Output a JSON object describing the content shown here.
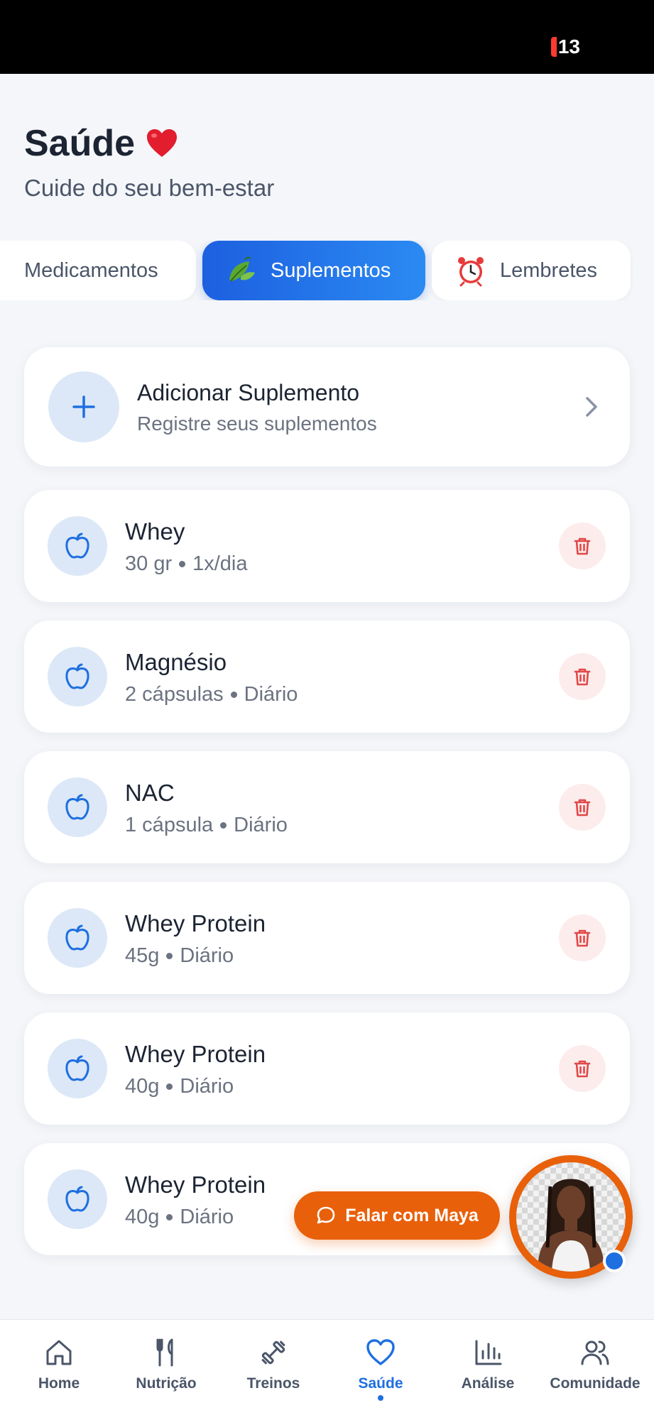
{
  "status_bar": {
    "battery": "13"
  },
  "header": {
    "title": "Saúde",
    "subtitle": "Cuide do seu bem-estar"
  },
  "tabs": [
    {
      "label": "Medicamentos",
      "active": false
    },
    {
      "label": "Suplementos",
      "active": true
    },
    {
      "label": "Lembretes",
      "active": false
    }
  ],
  "add_card": {
    "title": "Adicionar Suplemento",
    "subtitle": "Registre seus suplementos"
  },
  "supplements": [
    {
      "name": "Whey",
      "dose": "30 gr",
      "frequency": "1x/dia"
    },
    {
      "name": "Magnésio",
      "dose": "2 cápsulas",
      "frequency": "Diário"
    },
    {
      "name": "NAC",
      "dose": "1 cápsula",
      "frequency": "Diário"
    },
    {
      "name": "Whey Protein",
      "dose": "45g",
      "frequency": "Diário"
    },
    {
      "name": "Whey Protein",
      "dose": "40g",
      "frequency": "Diário"
    },
    {
      "name": "Whey Protein",
      "dose": "40g",
      "frequency": "Diário"
    }
  ],
  "maya": {
    "button_label": "Falar com Maya"
  },
  "bottom_nav": [
    {
      "label": "Home",
      "icon": "home-icon",
      "active": false
    },
    {
      "label": "Nutrição",
      "icon": "fork-knife-icon",
      "active": false
    },
    {
      "label": "Treinos",
      "icon": "dumbbell-icon",
      "active": false
    },
    {
      "label": "Saúde",
      "icon": "heart-icon",
      "active": true
    },
    {
      "label": "Análise",
      "icon": "bar-chart-icon",
      "active": false
    },
    {
      "label": "Comunidade",
      "icon": "users-icon",
      "active": false
    }
  ],
  "colors": {
    "accent": "#1e6fe0",
    "maya_orange": "#e8600a",
    "delete_red": "#e04848"
  }
}
